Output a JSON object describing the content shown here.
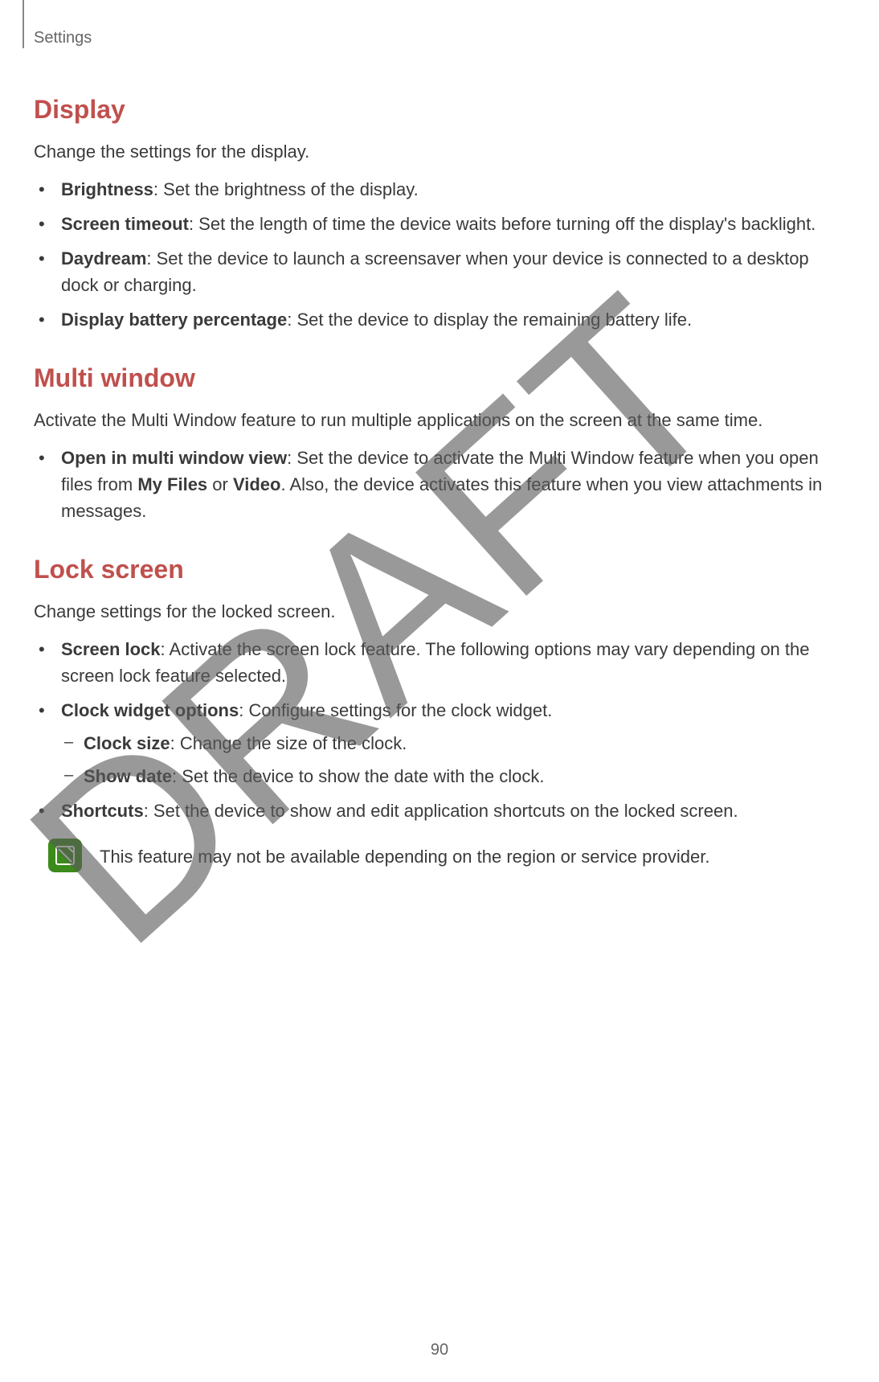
{
  "header": {
    "label": "Settings"
  },
  "watermark": "DRAFT",
  "page_number": "90",
  "sections": {
    "display": {
      "title": "Display",
      "intro": "Change the settings for the display.",
      "items": [
        {
          "term": "Brightness",
          "desc": ": Set the brightness of the display."
        },
        {
          "term": "Screen timeout",
          "desc": ": Set the length of time the device waits before turning off the display's backlight."
        },
        {
          "term": "Daydream",
          "desc": ": Set the device to launch a screensaver when your device is connected to a desktop dock or charging."
        },
        {
          "term": "Display battery percentage",
          "desc": ": Set the device to display the remaining battery life."
        }
      ]
    },
    "multiwindow": {
      "title": "Multi window",
      "intro": "Activate the Multi Window feature to run multiple applications on the screen at the same time.",
      "items": [
        {
          "term": "Open in multi window view",
          "desc_pre": ": Set the device to activate the Multi Window feature when you open files from ",
          "bold1": "My Files",
          "mid": " or ",
          "bold2": "Video",
          "desc_post": ". Also, the device activates this feature when you view attachments in messages."
        }
      ]
    },
    "lockscreen": {
      "title": "Lock screen",
      "intro": "Change settings for the locked screen.",
      "items": [
        {
          "term": "Screen lock",
          "desc": ": Activate the screen lock feature. The following options may vary depending on the screen lock feature selected."
        },
        {
          "term": "Clock widget options",
          "desc": ": Configure settings for the clock widget.",
          "sub": [
            {
              "term": "Clock size",
              "desc": ": Change the size of the clock."
            },
            {
              "term": "Show date",
              "desc": ": Set the device to show the date with the clock."
            }
          ]
        },
        {
          "term": "Shortcuts",
          "desc": ": Set the device to show and edit application shortcuts on the locked screen."
        }
      ],
      "note": "This feature may not be available depending on the region or service provider."
    }
  }
}
